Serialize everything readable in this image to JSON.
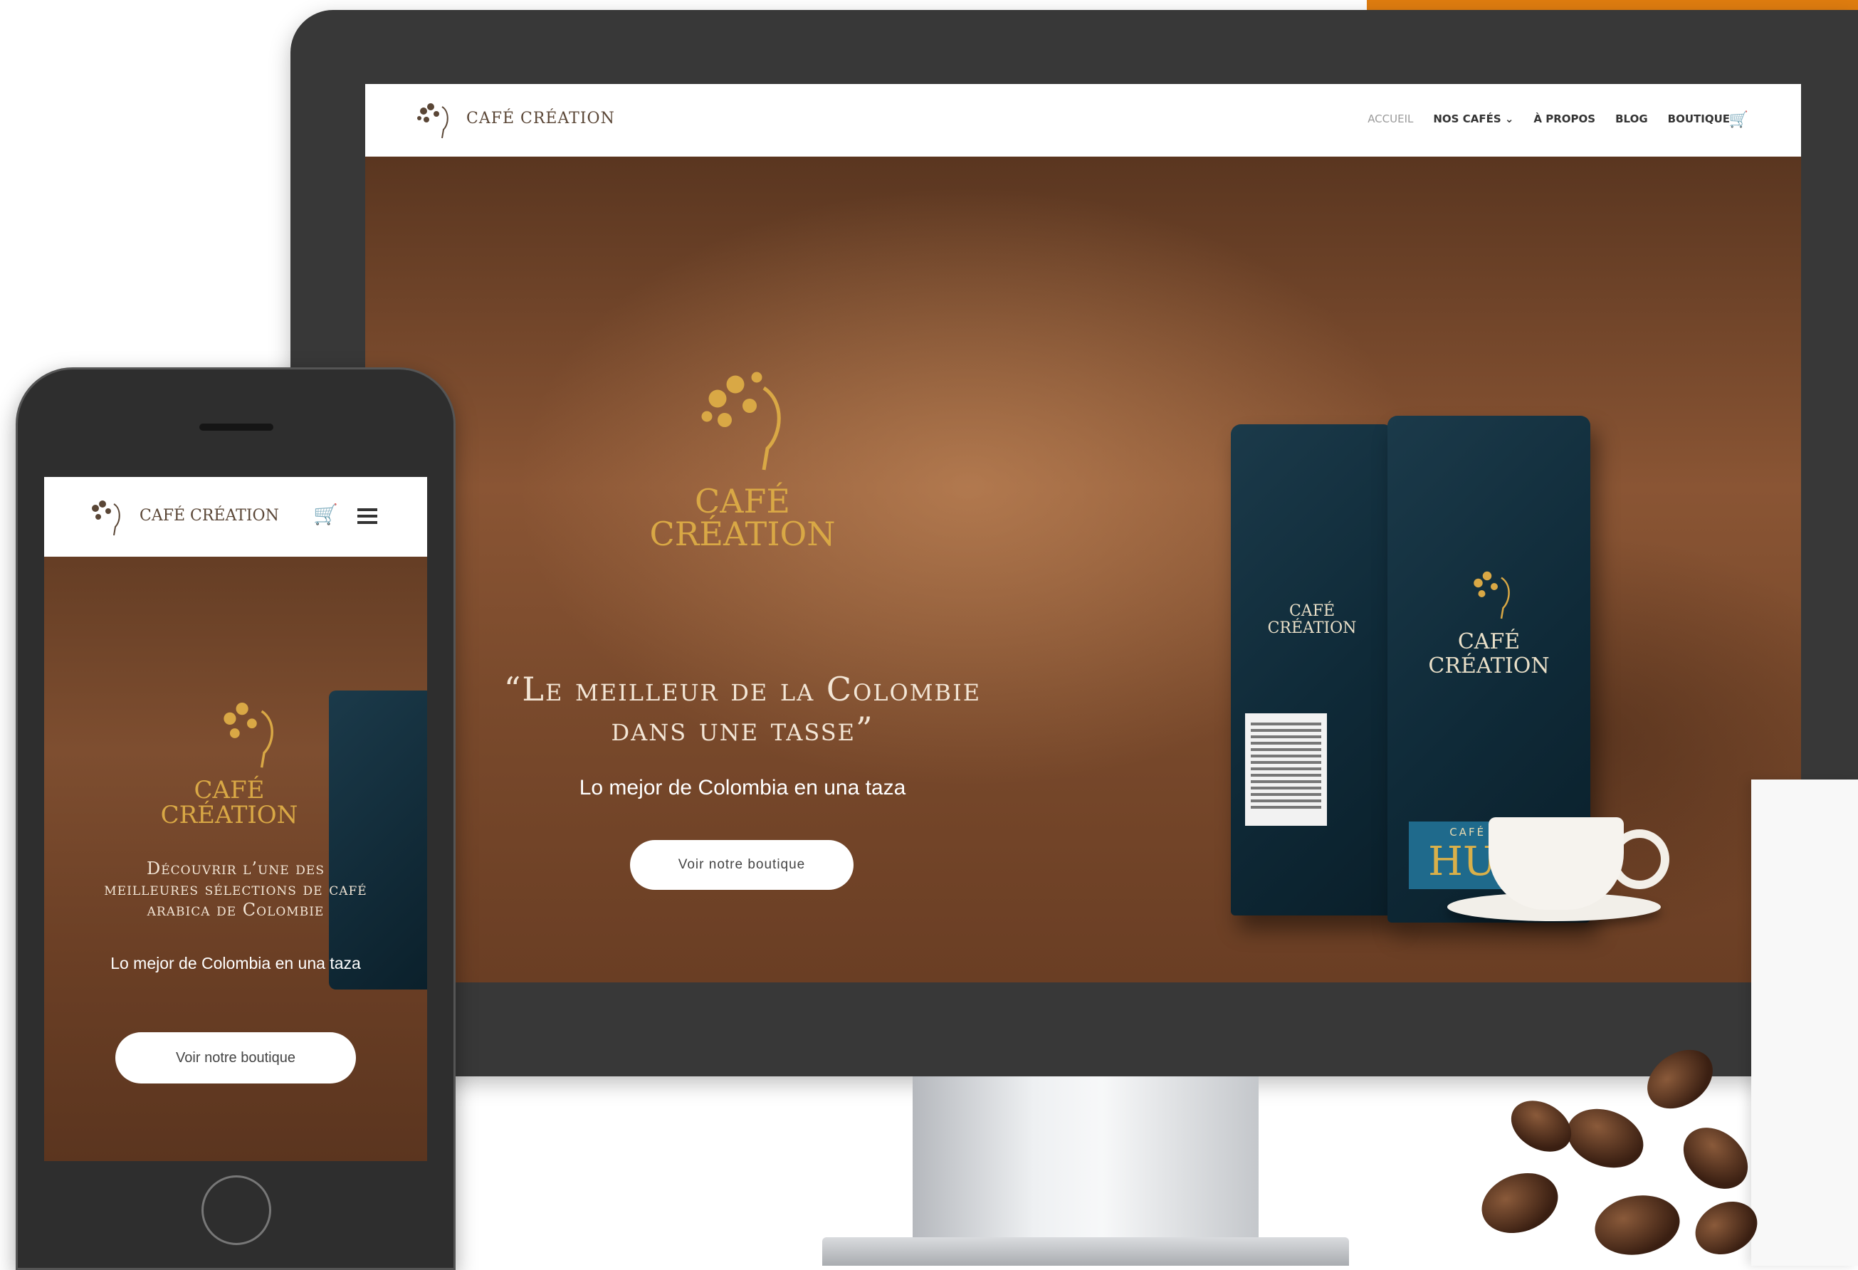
{
  "brand": {
    "name": "CAFÉ CRÉATION",
    "hero_line1": "CAFÉ",
    "hero_line2": "CRÉATION"
  },
  "desktop": {
    "nav": [
      "ACCUEIL",
      "NOS CAFÉS ⌄",
      "À PROPOS",
      "BLOG",
      "BOUTIQUE"
    ],
    "cart_icon": "cart-icon",
    "hero": {
      "quote_line1": "“Le meilleur de la Colombie",
      "quote_line2": "dans une tasse”",
      "subtitle": "Lo mejor de Colombia en una taza",
      "button": "Voir notre boutique"
    },
    "product": {
      "bag_brand_line1": "CAFÉ",
      "bag_brand_line2": "CRÉATION",
      "origin_label": "CAFÉ ORIGEN",
      "origin_name": "HUILA"
    }
  },
  "mobile": {
    "hero": {
      "title_line1": "Découvrir l’une des",
      "title_line2": "meilleures sélections de café",
      "title_line3": "arabica de Colombie",
      "subtitle": "Lo mejor de Colombia en una taza",
      "button": "Voir notre boutique"
    },
    "icons": [
      "cart-icon",
      "hamburger-menu-icon"
    ]
  },
  "colors": {
    "accent_gold": "#d9a845",
    "orange": "#e07d10",
    "dark_device": "#383838",
    "coffee_brown": "#7a4a2c"
  }
}
